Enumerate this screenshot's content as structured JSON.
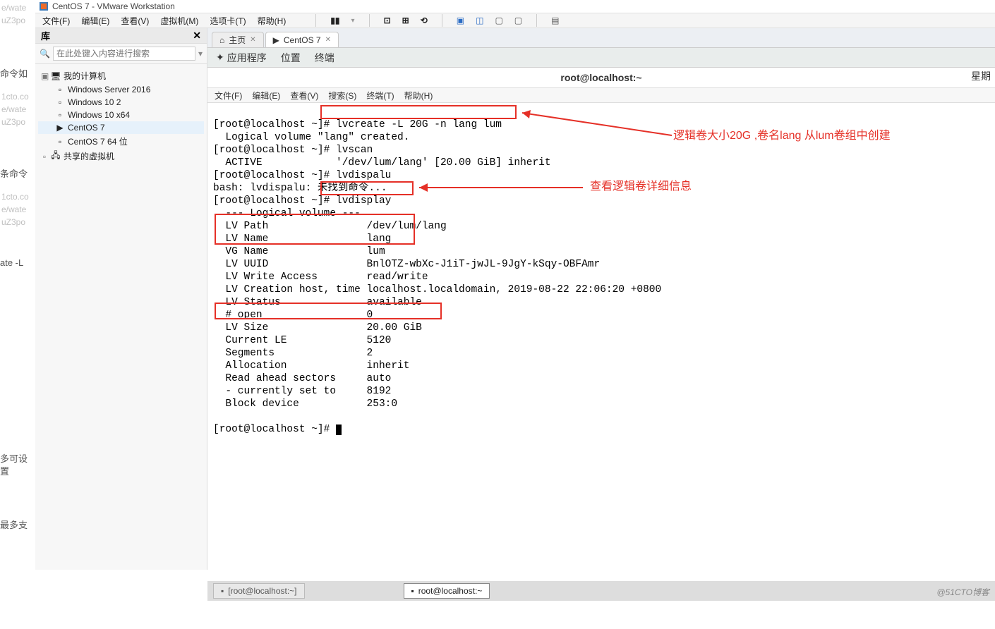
{
  "app_title": "CentOS 7 - VMware Workstation",
  "menubar": [
    "文件(F)",
    "编辑(E)",
    "查看(V)",
    "虚拟机(M)",
    "选项卡(T)",
    "帮助(H)"
  ],
  "sidebar": {
    "header": "库",
    "search_placeholder": "在此处键入内容进行搜索",
    "root": "我的计算机",
    "items": [
      "Windows Server 2016",
      "Windows 10 2",
      "Windows 10 x64",
      "CentOS 7",
      "CentOS 7 64 位"
    ],
    "shared": "共享的虚拟机"
  },
  "tabs": {
    "home": "主页",
    "centos": "CentOS 7"
  },
  "gnome_bar": {
    "apps": "应用程序",
    "places": "位置",
    "terminal": "终端",
    "time_partial": "星期"
  },
  "window_title": "root@localhost:~",
  "term_menu": [
    "文件(F)",
    "编辑(E)",
    "查看(V)",
    "搜索(S)",
    "终端(T)",
    "帮助(H)"
  ],
  "gutter": {
    "l1": "e/wate",
    "l2": "uZ3po",
    "l3": "命令如",
    "l4": "1cto.co",
    "l5": "e/wate",
    "l6": "uZ3po",
    "l7": "条命令",
    "l8": "1cto.co",
    "l9": "e/wate",
    "l10": "uZ3po",
    "l11": "ate -L",
    "l12": "多可设置",
    "l13": "最多支"
  },
  "terminal_lines": {
    "p1a": "[root@localhost ~]",
    "p1b": "# lvcreate -L 20G -n lang lum",
    "p2": "  Logical volume \"lang\" created.",
    "p3": "[root@localhost ~]# lvscan",
    "p4": "  ACTIVE            '/dev/lum/lang' [20.00 GiB] inherit",
    "p5": "[root@localhost ~]# lvdispalu",
    "p6": "bash: lvdispalu: 未找到命令...",
    "p7a": "[root@localhost ~]",
    "p7b": "# lvdisplay",
    "p8": "  --- Logical volume ---",
    "p9": "  LV Path                /dev/lum/lang",
    "p10": "  LV Name                lang",
    "p11": "  VG Name                lum",
    "p12": "  LV UUID                BnlOTZ-wbXc-J1iT-jwJL-9JgY-kSqy-OBFAmr",
    "p13": "  LV Write Access        read/write",
    "p14": "  LV Creation host, time localhost.localdomain, 2019-08-22 22:06:20 +0800",
    "p15": "  LV Status              available",
    "p16": "  # open                 0",
    "p17": "  LV Size                20.00 GiB",
    "p18": "  Current LE             5120",
    "p19": "  Segments               2",
    "p20": "  Allocation             inherit",
    "p21": "  Read ahead sectors     auto",
    "p22": "  - currently set to     8192",
    "p23": "  Block device           253:0",
    "p24": "",
    "p25a": "[root@localhost ~]# "
  },
  "annotations": {
    "top": "逻辑卷大小20G ,卷名lang 从lum卷组中创建",
    "mid": "查看逻辑卷详细信息"
  },
  "taskbar": {
    "inactive": "[root@localhost:~]",
    "active": "root@localhost:~"
  },
  "watermark": "@51CTO博客"
}
